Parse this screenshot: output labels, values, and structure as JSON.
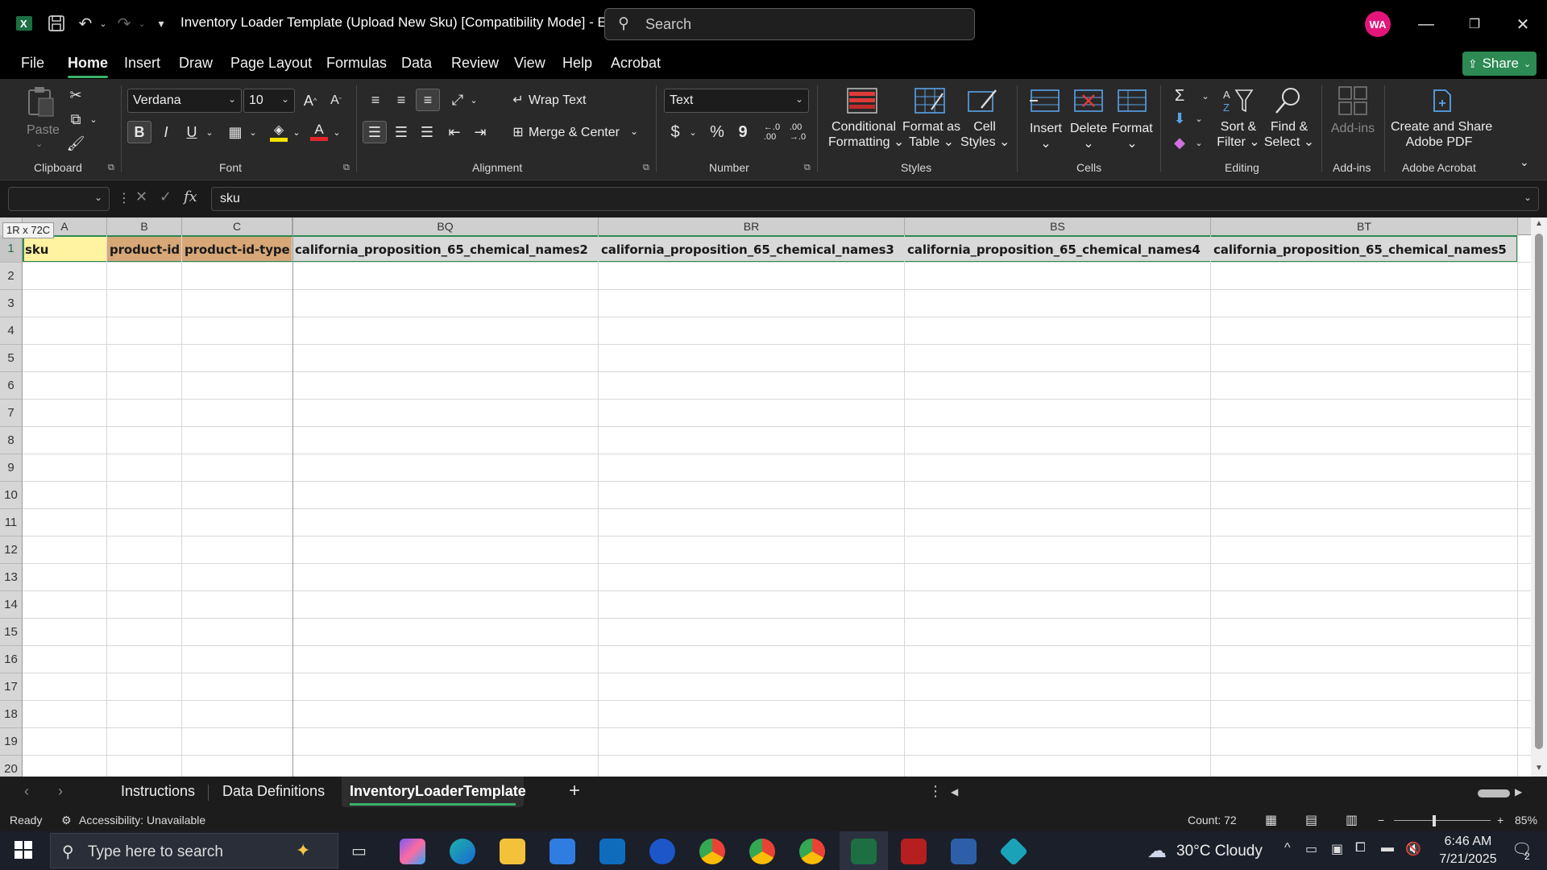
{
  "window": {
    "title": "Inventory Loader Template (Upload New Sku)  [Compatibility Mode]  -  E...",
    "search_placeholder": "Search",
    "avatar_initials": "WA"
  },
  "menu": {
    "tabs": [
      "File",
      "Home",
      "Insert",
      "Draw",
      "Page Layout",
      "Formulas",
      "Data",
      "Review",
      "View",
      "Help",
      "Acrobat"
    ],
    "active": "Home",
    "share_label": "Share"
  },
  "ribbon": {
    "clipboard": {
      "paste": "Paste",
      "label": "Clipboard"
    },
    "font": {
      "name": "Verdana",
      "size": "10",
      "label": "Font",
      "bold": "B",
      "italic": "I",
      "underline": "U"
    },
    "alignment": {
      "wrap_text": "Wrap Text",
      "merge_center": "Merge & Center",
      "label": "Alignment"
    },
    "number": {
      "format": "Text",
      "label": "Number",
      "currency": "$",
      "percent": "%",
      "comma": "9"
    },
    "styles": {
      "conditional_1": "Conditional",
      "conditional_2": "Formatting",
      "format_table_1": "Format as",
      "format_table_2": "Table",
      "cell_styles_1": "Cell",
      "cell_styles_2": "Styles",
      "label": "Styles"
    },
    "cells": {
      "insert": "Insert",
      "delete": "Delete",
      "format": "Format",
      "label": "Cells"
    },
    "editing": {
      "sort_1": "Sort &",
      "sort_2": "Filter",
      "find_1": "Find &",
      "find_2": "Select",
      "label": "Editing"
    },
    "addins": {
      "addins": "Add-ins",
      "label": "Add-ins"
    },
    "acrobat": {
      "create_1": "Create and Share",
      "create_2": "Adobe PDF",
      "label": "Adobe Acrobat"
    }
  },
  "formula_bar": {
    "name_box": "",
    "fx": "fx",
    "value": "sku"
  },
  "grid": {
    "selection_tooltip": "1R x 72C",
    "columns": [
      "A",
      "B",
      "C",
      "BQ",
      "BR",
      "BS",
      "BT"
    ],
    "row_numbers": [
      "1",
      "2",
      "3",
      "4",
      "5",
      "6",
      "7",
      "8",
      "9",
      "10",
      "11",
      "12",
      "13",
      "14",
      "15",
      "16",
      "17",
      "18",
      "19",
      "20"
    ],
    "row1": [
      "sku",
      "product-id",
      "product-id-type",
      "california_proposition_65_chemical_names2",
      "california_proposition_65_chemical_names3",
      "california_proposition_65_chemical_names4",
      "california_proposition_65_chemical_names5"
    ],
    "colors": {
      "a1_fill": "#fff2a0",
      "bc_fill": "#d7a777",
      "rest_fill": "#d9d9d9"
    }
  },
  "sheets": {
    "tabs": [
      "Instructions",
      "Data Definitions",
      "InventoryLoaderTemplate"
    ],
    "active": "InventoryLoaderTemplate",
    "add": "+"
  },
  "status": {
    "ready": "Ready",
    "accessibility": "Accessibility: Unavailable",
    "count": "Count: 72",
    "zoom": "85%"
  },
  "taskbar": {
    "search_placeholder": "Type here to search",
    "weather": "30°C  Cloudy",
    "time": "6:46 AM",
    "date": "7/21/2025",
    "notifications": "2"
  }
}
